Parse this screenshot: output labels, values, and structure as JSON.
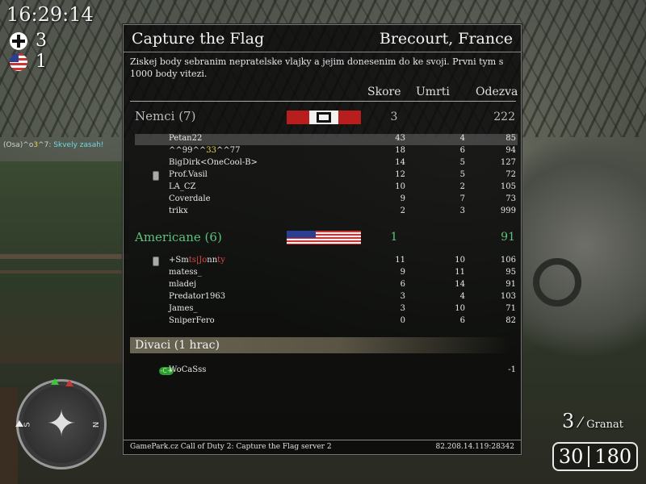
{
  "hud": {
    "clock": "16:29:14",
    "axis_score": "3",
    "allies_score": "1",
    "chat": {
      "prefix": "(Osa)^",
      "name_a": "o",
      "name_b": "3",
      "name_c": "^7:",
      "message": "Skvely zasah!"
    },
    "weapon_count": "3",
    "weapon_name": "Granat",
    "ammo_clip": "30",
    "ammo_reserve": "180"
  },
  "scoreboard": {
    "game_type": "Capture the Flag",
    "map": "Brecourt, France",
    "objective": "Ziskej body sebranim nepratelske vlajky a jejim donesenim do ke svoji.  Prvni tym s 1000 body vitezi.",
    "columns": {
      "score": "Skore",
      "deaths": "Umrti",
      "ping": "Odezva"
    },
    "axis": {
      "name": "Nemci (7)",
      "score": "3",
      "ping": "222",
      "players": [
        {
          "name": "Petan22",
          "score": "43",
          "deaths": "4",
          "ping": "85",
          "highlight": true
        },
        {
          "name_parts": [
            "^^99^^",
            "33",
            "^^77"
          ],
          "score": "18",
          "deaths": "6",
          "ping": "94"
        },
        {
          "name": "BigDirk<OneCool-B>",
          "score": "14",
          "deaths": "5",
          "ping": "127"
        },
        {
          "name": "Prof.Vasil",
          "score": "12",
          "deaths": "5",
          "ping": "72",
          "has_tag": true
        },
        {
          "name": "LA_CZ",
          "score": "10",
          "deaths": "2",
          "ping": "105"
        },
        {
          "name": "Coverdale",
          "score": "9",
          "deaths": "7",
          "ping": "73"
        },
        {
          "name": "trikx",
          "score": "2",
          "deaths": "3",
          "ping": "999"
        }
      ]
    },
    "allies": {
      "name": "Americane (6)",
      "score": "1",
      "ping": "91",
      "players": [
        {
          "name_parts": [
            "+Sm",
            "ts|Jo",
            "nn",
            "ty"
          ],
          "score": "11",
          "deaths": "10",
          "ping": "106",
          "has_tag": true
        },
        {
          "name": "matess_",
          "score": "9",
          "deaths": "11",
          "ping": "95"
        },
        {
          "name": "mladej",
          "score": "6",
          "deaths": "14",
          "ping": "91"
        },
        {
          "name": "Predator1963",
          "score": "3",
          "deaths": "4",
          "ping": "103"
        },
        {
          "name": "James_",
          "score": "3",
          "deaths": "10",
          "ping": "71"
        },
        {
          "name": "SniperFero",
          "score": "0",
          "deaths": "6",
          "ping": "82"
        }
      ]
    },
    "spectators": {
      "name": "Divaci (1 hrac)",
      "players": [
        {
          "name": "WoCaSss",
          "ping": "-1",
          "icon": "-C+"
        }
      ]
    },
    "footer_left": "GamePark.cz Call of Duty 2: Capture the Flag server 2",
    "footer_right": "82.208.14.119:28342"
  },
  "compass": {
    "north": "N",
    "south": "S"
  },
  "colors": {
    "axis_team": "#bdbdbd",
    "allies_team": "#5ec27a",
    "highlight": "#e8d84a"
  }
}
